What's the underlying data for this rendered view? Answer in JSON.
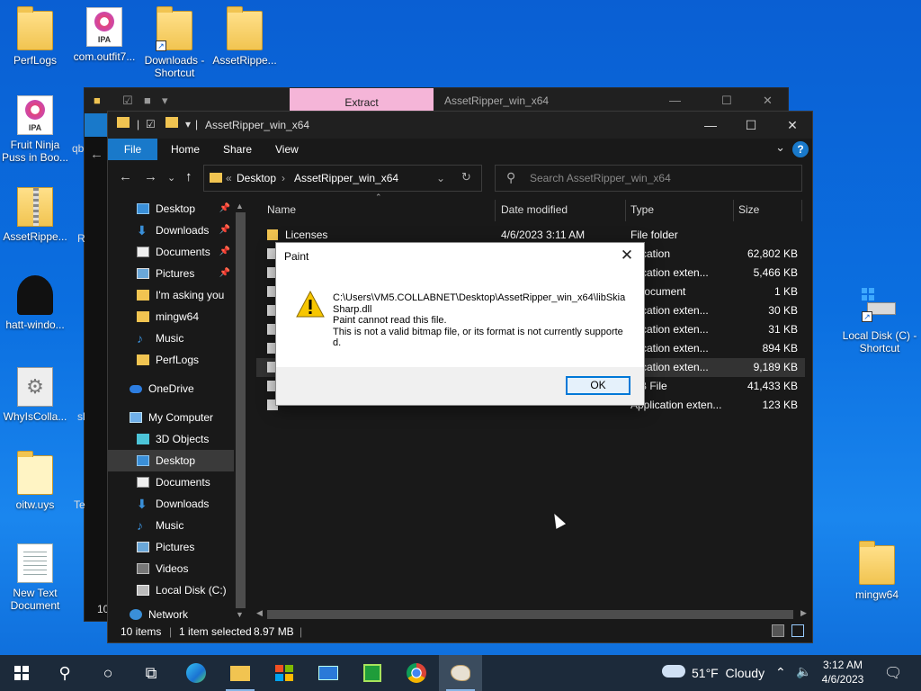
{
  "desktop": {
    "icons": [
      {
        "label": "PerfLogs",
        "icon": "folder-icon"
      },
      {
        "label": "com.outfit7...",
        "icon": "ipa-file-icon"
      },
      {
        "label": "Downloads - Shortcut",
        "icon": "downloads-shortcut-icon"
      },
      {
        "label": "AssetRippe...",
        "icon": "folder-icon"
      },
      {
        "label": "Fruit Ninja Puss in Boo...",
        "icon": "ipa-file-icon"
      },
      {
        "label": "AssetRippe...",
        "icon": "zip-folder-icon"
      },
      {
        "label": "hatt-windo...",
        "icon": "app-icon"
      },
      {
        "label": "WhyIsColla...",
        "icon": "settings-file-icon"
      },
      {
        "label": "oitw.uys",
        "icon": "file-icon"
      },
      {
        "label": "New Text Document",
        "icon": "text-document-icon"
      },
      {
        "label": "Local Disk (C) - Shortcut",
        "icon": "drive-shortcut-icon"
      },
      {
        "label": "mingw64",
        "icon": "folder-icon"
      }
    ],
    "partial_labels": [
      "qb",
      "R",
      "sl",
      "Te",
      "10"
    ]
  },
  "back_window": {
    "tab_label": "Extract",
    "title": "AssetRipper_win_x64"
  },
  "explorer": {
    "title": "AssetRipper_win_x64",
    "ribbon_tabs": [
      "File",
      "Home",
      "Share",
      "View"
    ],
    "address": {
      "prefix": "«",
      "crumbs": [
        "Desktop",
        "AssetRipper_win_x64"
      ]
    },
    "search_placeholder": "Search AssetRipper_win_x64",
    "nav_items": [
      {
        "label": "Desktop",
        "icon": "desktop-icon",
        "pinned": true
      },
      {
        "label": "Downloads",
        "icon": "download-icon",
        "pinned": true
      },
      {
        "label": "Documents",
        "icon": "documents-icon",
        "pinned": true
      },
      {
        "label": "Pictures",
        "icon": "pictures-icon",
        "pinned": true
      },
      {
        "label": "I'm asking you",
        "icon": "folder-icon",
        "pinned": false
      },
      {
        "label": "mingw64",
        "icon": "folder-icon",
        "pinned": false
      },
      {
        "label": "Music",
        "icon": "music-icon",
        "pinned": false
      },
      {
        "label": "PerfLogs",
        "icon": "folder-icon",
        "pinned": false
      },
      {
        "label": "OneDrive",
        "icon": "onedrive-icon",
        "pinned": false
      },
      {
        "label": "My Computer",
        "icon": "computer-icon",
        "pinned": false
      },
      {
        "label": "3D Objects",
        "icon": "3d-objects-icon",
        "pinned": false
      },
      {
        "label": "Desktop",
        "icon": "desktop-icon",
        "pinned": false
      },
      {
        "label": "Documents",
        "icon": "documents-icon",
        "pinned": false
      },
      {
        "label": "Downloads",
        "icon": "download-icon",
        "pinned": false
      },
      {
        "label": "Music",
        "icon": "music-icon",
        "pinned": false
      },
      {
        "label": "Pictures",
        "icon": "pictures-icon",
        "pinned": false
      },
      {
        "label": "Videos",
        "icon": "videos-icon",
        "pinned": false
      },
      {
        "label": "Local Disk (C:)",
        "icon": "drive-icon",
        "pinned": false
      },
      {
        "label": "Network",
        "icon": "network-icon",
        "pinned": false
      }
    ],
    "columns": [
      "Name",
      "Date modified",
      "Type",
      "Size"
    ],
    "files": [
      {
        "name": "Licenses",
        "date": "4/6/2023 3:11 AM",
        "type": "File folder",
        "size": ""
      },
      {
        "name": "",
        "date": "",
        "type": "plication",
        "size": "62,802 KB"
      },
      {
        "name": "",
        "date": "",
        "type": "plication exten...",
        "size": "5,466 KB"
      },
      {
        "name": "",
        "date": "",
        "type": "t Document",
        "size": "1 KB"
      },
      {
        "name": "",
        "date": "",
        "type": "plication exten...",
        "size": "30 KB"
      },
      {
        "name": "",
        "date": "",
        "type": "plication exten...",
        "size": "31 KB"
      },
      {
        "name": "",
        "date": "",
        "type": "plication exten...",
        "size": "894 KB"
      },
      {
        "name": "",
        "date": "",
        "type": "plication exten...",
        "size": "9,189 KB"
      },
      {
        "name": "",
        "date": "",
        "type": "LIB File",
        "size": "41,433 KB"
      },
      {
        "name": "",
        "date": "",
        "type": "Application exten...",
        "size": "123 KB"
      }
    ],
    "status": {
      "count": "10 items",
      "selection": "1 item selected",
      "size": "8.97 MB"
    }
  },
  "dialog": {
    "title": "Paint",
    "path": "C:\\Users\\VM5.COLLABNET\\Desktop\\AssetRipper_win_x64\\libSkiaSharp.dll",
    "line1": "Paint cannot read this file.",
    "line2": "This is not a valid bitmap file, or its format is not currently supported.",
    "ok_label": "OK"
  },
  "taskbar": {
    "weather": "51°F  Cloudy",
    "time": "3:12 AM",
    "date": "4/6/2023",
    "apps": [
      "start-icon",
      "search-icon",
      "cortana-icon",
      "task-view-icon",
      "edge-icon",
      "file-explorer-icon",
      "store-icon",
      "mail-icon",
      "excel-icon",
      "chrome-icon",
      "paint-icon"
    ]
  }
}
